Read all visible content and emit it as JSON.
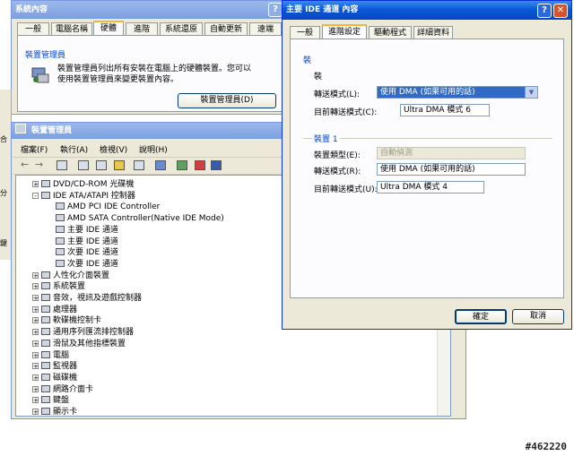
{
  "sysprop": {
    "title": "系統內容",
    "tabs": [
      "一般",
      "電腦名稱",
      "硬體",
      "進階",
      "系統還原",
      "自動更新",
      "遠端"
    ],
    "group_title": "裝置管理員",
    "desc_line1": "裝置管理員列出所有安裝在電腦上的硬體裝置。您可以",
    "desc_line2": "使用裝置管理員來變更裝置內容。",
    "btn": "裝置管理員(D)"
  },
  "devmgr": {
    "title": "裝置管理員",
    "menus": [
      "檔案(F)",
      "執行(A)",
      "檢視(V)",
      "說明(H)"
    ],
    "tree": [
      {
        "expander": "+",
        "label": "DVD/CD-ROM 光碟機"
      },
      {
        "expander": "-",
        "label": "IDE ATA/ATAPI 控制器"
      },
      {
        "expander": "",
        "label": "AMD PCI IDE Controller"
      },
      {
        "expander": "",
        "label": "AMD SATA Controller(Native IDE Mode)"
      },
      {
        "expander": "",
        "label": "主要 IDE 通道"
      },
      {
        "expander": "",
        "label": "主要 IDE 通道"
      },
      {
        "expander": "",
        "label": "次要 IDE 通道"
      },
      {
        "expander": "",
        "label": "次要 IDE 通道"
      },
      {
        "expander": "+",
        "label": "人性化介面裝置"
      },
      {
        "expander": "+",
        "label": "系統裝置"
      },
      {
        "expander": "+",
        "label": "音效，視訊及遊戲控制器"
      },
      {
        "expander": "+",
        "label": "處理器"
      },
      {
        "expander": "+",
        "label": "軟碟機控制卡"
      },
      {
        "expander": "+",
        "label": "通用序列匯流排控制器"
      },
      {
        "expander": "+",
        "label": "滑鼠及其他指標裝置"
      },
      {
        "expander": "+",
        "label": "電腦"
      },
      {
        "expander": "+",
        "label": "監視器"
      },
      {
        "expander": "+",
        "label": "磁碟機"
      },
      {
        "expander": "+",
        "label": "網路介面卡"
      },
      {
        "expander": "+",
        "label": "鍵盤"
      },
      {
        "expander": "+",
        "label": "顯示卡"
      }
    ]
  },
  "ideprop": {
    "title": "主要 IDE 通道 內容",
    "tabs": [
      "一般",
      "進階設定",
      "驅動程式",
      "詳細資料"
    ],
    "dev0": {
      "group": "裝",
      "type_label": "裝",
      "mode_label": "轉送模式(L):",
      "mode_value": "使用 DMA (如果可用的話)",
      "current_label": "目前轉送模式(C):",
      "current_value": "Ultra DMA 模式 6"
    },
    "dev1": {
      "group": "裝置 1",
      "type_label": "裝置類型(E):",
      "type_value": "自動偵測",
      "mode_label": "轉送模式(R):",
      "mode_value": "使用 DMA (如果可用的話)",
      "current_label": "目前轉送模式(U):",
      "current_value": "Ultra DMA 模式 4"
    },
    "ok": "確定",
    "cancel": "取消"
  },
  "side_marks": [
    "合",
    "分",
    "鍵"
  ],
  "watermark": "#462220",
  "colors": {
    "titlebar": "#0a58d8",
    "dialog": "#ece9d8",
    "selection": "#316ac5"
  }
}
